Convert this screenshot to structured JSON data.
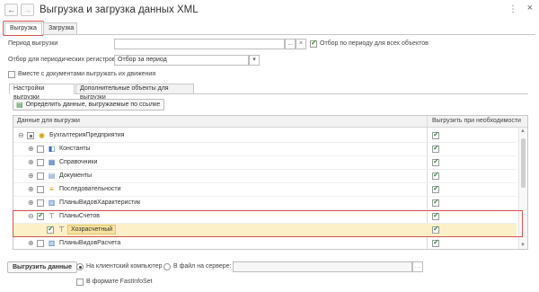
{
  "window": {
    "title": "Выгрузка и загрузка данных XML",
    "menu_icon": "more-vertical-icon",
    "close_icon": "close-icon"
  },
  "nav": {
    "back": "←",
    "forward": "→"
  },
  "tabs": [
    {
      "label": "Выгрузка",
      "active": true
    },
    {
      "label": "Загрузка",
      "active": false
    }
  ],
  "form": {
    "period_label": "Период выгрузки",
    "period_value": "",
    "period_btn1": "...",
    "period_btn2": "×",
    "filter_all_label": "Отбор по периоду для всех объектов",
    "filter_all_checked": true,
    "registers_label": "Отбор для периодических регистров:",
    "registers_value": "Отбор за период",
    "docs_movements_label": "Вместе с документами выгружать их движения",
    "docs_movements_checked": false
  },
  "subtabs": [
    {
      "label": "Настройки выгрузки",
      "active": true
    },
    {
      "label": "Дополнительные объекты для выгрузки",
      "active": false
    }
  ],
  "define_button": "Определить данные, выгружаемые по ссылке",
  "table": {
    "col_data": "Данные для выгрузки",
    "col_need": "Выгрузить при необходимости",
    "rows": [
      {
        "label": "БухгалтерияПредприятия",
        "icon": "configuration-icon",
        "checked": "partial",
        "need": true
      },
      {
        "label": "Константы",
        "icon": "constants-icon",
        "checked": false,
        "need": true
      },
      {
        "label": "Справочники",
        "icon": "catalogs-icon",
        "checked": false,
        "need": true
      },
      {
        "label": "Документы",
        "icon": "documents-icon",
        "checked": false,
        "need": true
      },
      {
        "label": "Последовательности",
        "icon": "sequences-icon",
        "checked": false,
        "need": true
      },
      {
        "label": "ПланыВидовХарактеристик",
        "icon": "characteristics-icon",
        "checked": false,
        "need": true
      },
      {
        "label": "ПланыСчетов",
        "icon": "chart-of-accounts-icon",
        "checked": true,
        "need": true
      },
      {
        "label": "Хозрасчетный",
        "icon": "chart-of-accounts-icon",
        "checked": true,
        "need": true
      },
      {
        "label": "ПланыВидовРасчета",
        "icon": "calculation-types-icon",
        "checked": false,
        "need": true
      }
    ]
  },
  "bottom": {
    "export_button": "Выгрузить данные",
    "client_label": "На клиентский компьютер",
    "server_label": "В файл на сервере:",
    "server_value": "",
    "fastinfoset_label": "В формате FastInfoSet",
    "fastinfoset_checked": false
  }
}
